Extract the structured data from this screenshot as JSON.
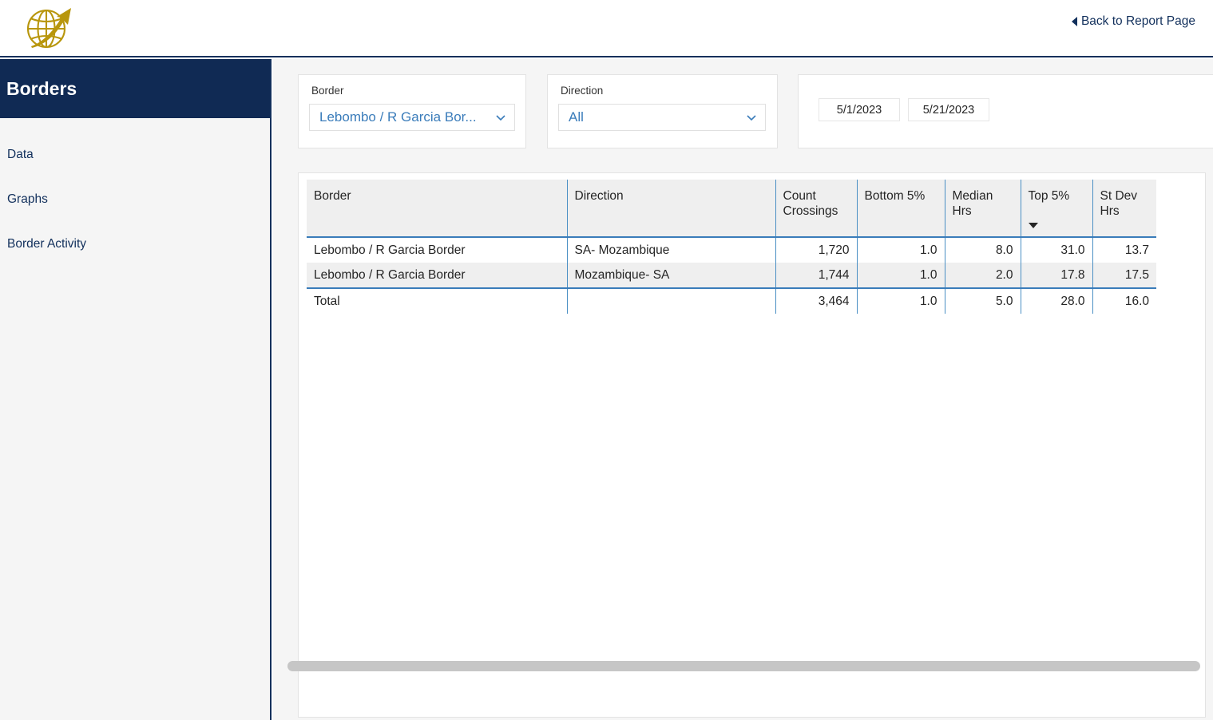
{
  "header": {
    "logo_icon": "globe-arrow-logo",
    "back_link": "Back to Report Page",
    "back_icon": "left-caret-icon"
  },
  "sidebar": {
    "title": "Borders",
    "items": [
      {
        "label": "Data"
      },
      {
        "label": "Graphs"
      },
      {
        "label": "Border Activity"
      }
    ]
  },
  "slicers": {
    "border": {
      "label": "Border",
      "value": "Lebombo / R Garcia Bor...",
      "icon": "chevron-down-icon"
    },
    "direction": {
      "label": "Direction",
      "value": "All",
      "icon": "chevron-down-icon"
    },
    "date": {
      "start": "5/1/2023",
      "end": "5/21/2023"
    }
  },
  "table": {
    "columns": [
      {
        "label": "Border",
        "align": "left"
      },
      {
        "label": "Direction",
        "align": "left"
      },
      {
        "label": "Count Crossings",
        "align": "right"
      },
      {
        "label": "Bottom 5%",
        "align": "right"
      },
      {
        "label": "Median Hrs",
        "align": "right"
      },
      {
        "label": "Top 5%",
        "align": "right",
        "sort": "desc"
      },
      {
        "label": "St Dev Hrs",
        "align": "right"
      }
    ],
    "rows": [
      {
        "border": "Lebombo / R Garcia Border",
        "direction": "SA- Mozambique",
        "count_crossings": "1,720",
        "bottom_5": "1.0",
        "median_hrs": "8.0",
        "top_5": "31.0",
        "st_dev_hrs": "13.7"
      },
      {
        "border": "Lebombo / R Garcia Border",
        "direction": "Mozambique- SA",
        "count_crossings": "1,744",
        "bottom_5": "1.0",
        "median_hrs": "2.0",
        "top_5": "17.8",
        "st_dev_hrs": "17.5"
      }
    ],
    "total": {
      "border": "Total",
      "direction": "",
      "count_crossings": "3,464",
      "bottom_5": "1.0",
      "median_hrs": "5.0",
      "top_5": "28.0",
      "st_dev_hrs": "16.0"
    }
  },
  "colors": {
    "navy": "#102a54",
    "gold": "#b8960c",
    "link_blue": "#3a7cba",
    "grid_blue": "#4a8fc4",
    "header_gray": "#efefef"
  }
}
